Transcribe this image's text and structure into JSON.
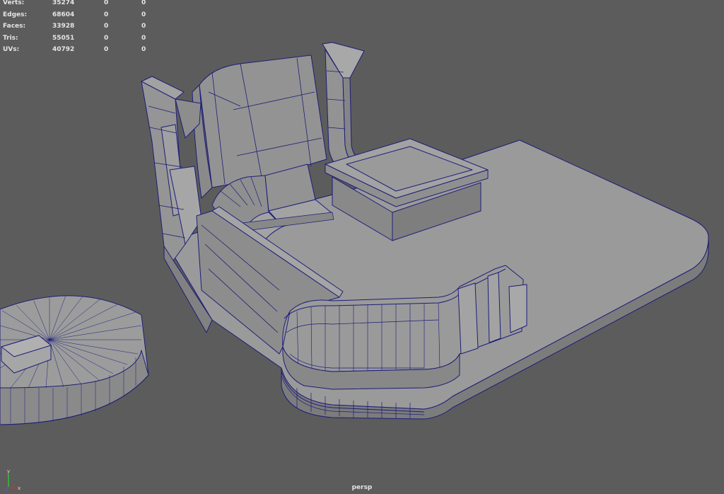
{
  "hud": {
    "rows": [
      {
        "label": "Verts:",
        "v1": "35274",
        "v2": "0",
        "v3": "0"
      },
      {
        "label": "Edges:",
        "v1": "68604",
        "v2": "0",
        "v3": "0"
      },
      {
        "label": "Faces:",
        "v1": "33928",
        "v2": "0",
        "v3": "0"
      },
      {
        "label": "Tris:",
        "v1": "55051",
        "v2": "0",
        "v3": "0"
      },
      {
        "label": "UVs:",
        "v1": "40792",
        "v2": "0",
        "v3": "0"
      }
    ]
  },
  "viewport": {
    "camera": "persp",
    "axis": {
      "y_label": "y",
      "x_label": "x"
    },
    "colors": {
      "background": "#5c5c5c",
      "mesh_fill": "#9a9a9a",
      "mesh_fill_dark": "#868686",
      "wireframe": "#1d1d7a",
      "hud_text": "#e4e4e4"
    }
  }
}
